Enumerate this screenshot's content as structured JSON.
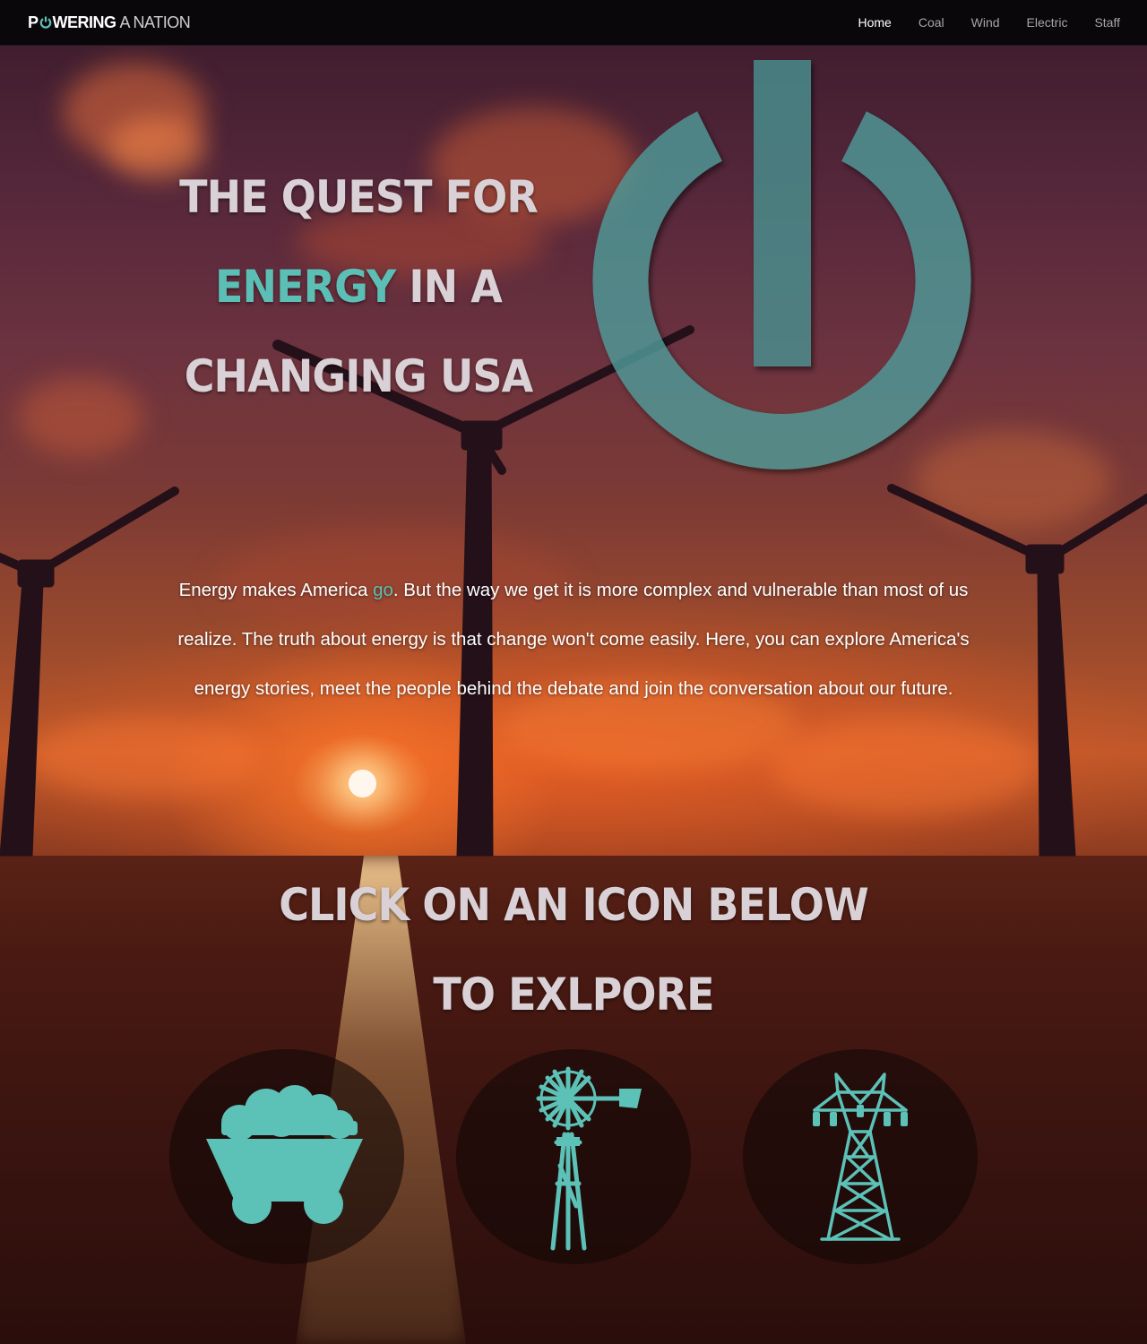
{
  "nav": {
    "brand_bold": "POWERING",
    "brand_light": "A NATION",
    "links": [
      {
        "label": "Home",
        "active": true
      },
      {
        "label": "Coal",
        "active": false
      },
      {
        "label": "Wind",
        "active": false
      },
      {
        "label": "Electric",
        "active": false
      },
      {
        "label": "Staff",
        "active": false
      }
    ]
  },
  "hero": {
    "line1": "THE QUEST FOR",
    "line2_accent": "ENERGY",
    "line2_rest": " IN A",
    "line3": "CHANGING USA"
  },
  "intro": {
    "before": "Energy makes America ",
    "accent": "go",
    "after": ". But the way we get it is more complex and vulnerable than most of us realize. The truth about energy is that change won't come easily. Here, you can explore America's energy stories, meet the people behind the debate and join the conversation about our future."
  },
  "cta": {
    "title": "CLICK ON AN ICON BELOW TO EXLPORE"
  },
  "icons": [
    {
      "name": "coal-cart-icon",
      "topic": "Coal"
    },
    {
      "name": "windmill-icon",
      "topic": "Wind"
    },
    {
      "name": "power-pylon-icon",
      "topic": "Electric"
    }
  ],
  "colors": {
    "accent": "#5cbfb5",
    "heading": "#d9d1d6",
    "navbar": "#08060a"
  }
}
